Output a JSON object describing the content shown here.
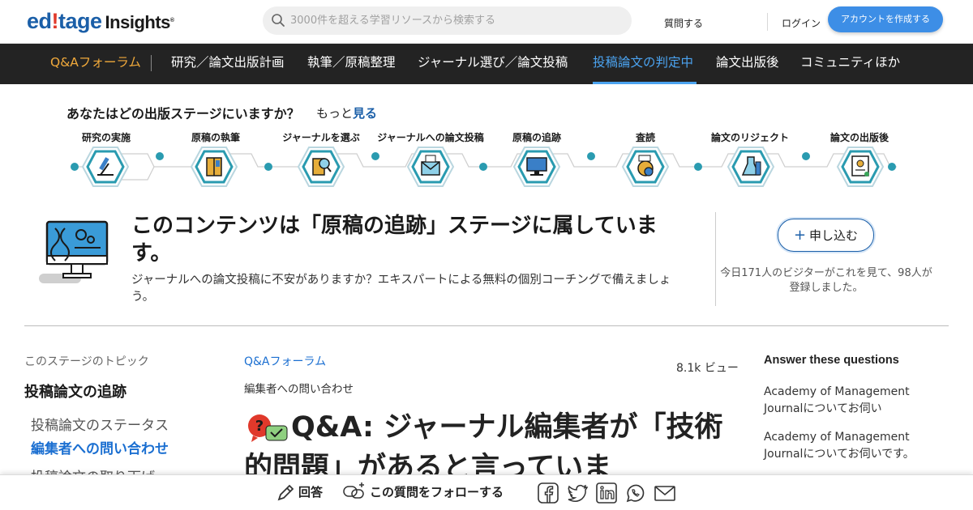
{
  "header": {
    "logo": {
      "part1": "ed",
      "part2": "!",
      "part3": "tage",
      "part4": "Insights",
      "mark": "®"
    },
    "search_placeholder": "3000件を超える学習リソースから検索する",
    "ask_label": "質問する",
    "login_label": "ログイン",
    "signup_label": "アカウントを作成する"
  },
  "nav": {
    "brand": "Q&Aフォーラム",
    "items": [
      "研究／論文出版計画",
      "執筆／原稿整理",
      "ジャーナル選び／論文投稿",
      "投稿論文の判定中",
      "論文出版後",
      "コミュニティほか"
    ],
    "active_index": 3
  },
  "stages": {
    "question": "あなたはどの出版ステージにいますか？",
    "more_prefix": "もっと",
    "more_link": "見る",
    "items": [
      {
        "label": "研究の実施",
        "icon": "microscope-icon"
      },
      {
        "label": "原稿の執筆",
        "icon": "notebook-icon"
      },
      {
        "label": "ジャーナルを選ぶ",
        "icon": "journal-search-icon"
      },
      {
        "label": "ジャーナルへの論文投稿",
        "icon": "envelope-icon"
      },
      {
        "label": "原稿の追跡",
        "icon": "monitor-tracking-icon"
      },
      {
        "label": "査読",
        "icon": "peer-review-icon"
      },
      {
        "label": "論文のリジェクト",
        "icon": "flask-reject-icon"
      },
      {
        "label": "論文の出版後",
        "icon": "certificate-icon"
      }
    ]
  },
  "banner": {
    "title": "このコンテンツは「原稿の追跡」ステージに属しています。",
    "subtitle": "ジャーナルへの論文投稿に不安がありますか？エキスパートによる無料の個別コーチングで備えましょう。",
    "apply_label": "申し込む",
    "visitors_text": "今日171人のビジターがこれを見て、98人が登録しました。"
  },
  "sidebar": {
    "label": "このステージのトピック",
    "heading": "投稿論文の追跡",
    "items": [
      "投稿論文のステータス",
      "編集者への問い合わせ",
      "投稿論文の取り下げ"
    ],
    "active_index": 1
  },
  "article": {
    "breadcrumb": "Q&Aフォーラム",
    "views": "8.1k ビュー",
    "category": "編集者への問い合わせ",
    "title": "Q&A: ジャーナル編集者が「技術的問題」があると言っていま"
  },
  "answers": {
    "heading": "Answer these questions",
    "items": [
      "Academy of Management Journalについてお伺い",
      "Academy of Management Journalについてお伺いです。"
    ]
  },
  "bottom_bar": {
    "answer_label": "回答",
    "follow_label": "この質問をフォローする",
    "share_icons": [
      "facebook-icon",
      "twitter-icon",
      "linkedin-icon",
      "whatsapp-icon",
      "mail-icon"
    ]
  },
  "colors": {
    "brand_blue": "#1b5fa8",
    "nav_bg": "#232323",
    "nav_brand": "#f0a93b",
    "nav_active": "#4ba3f0",
    "timeline_teal": "#2a9bb0",
    "signup_bg": "#3d8ee6"
  }
}
